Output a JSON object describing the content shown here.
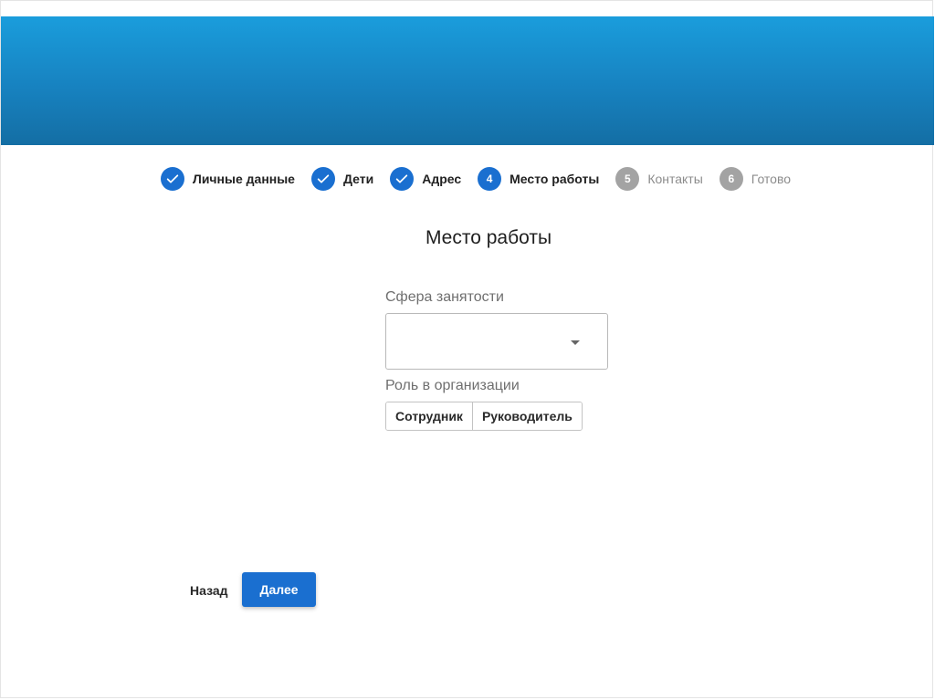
{
  "colors": {
    "accent": "#1a6fd0",
    "hero_top": "#1a9ddc",
    "hero_bottom": "#146ea4",
    "step_pending": "#a3a3a3"
  },
  "stepper": {
    "steps": [
      {
        "number": "1",
        "label": "Личные данные",
        "status": "done",
        "icon": "check-icon"
      },
      {
        "number": "2",
        "label": "Дети",
        "status": "done",
        "icon": "check-icon"
      },
      {
        "number": "3",
        "label": "Адрес",
        "status": "done",
        "icon": "check-icon"
      },
      {
        "number": "4",
        "label": "Место работы",
        "status": "active"
      },
      {
        "number": "5",
        "label": "Контакты",
        "status": "pending"
      },
      {
        "number": "6",
        "label": "Готово",
        "status": "pending"
      }
    ]
  },
  "main": {
    "title": "Место работы",
    "employment_label": "Сфера занятости",
    "employment_value": "",
    "employment_icon": "dropdown-arrow-icon",
    "role_label": "Роль в организации",
    "role_options": [
      "Сотрудник",
      "Руководитель"
    ]
  },
  "footer": {
    "back_label": "Назад",
    "next_label": "Далее"
  }
}
